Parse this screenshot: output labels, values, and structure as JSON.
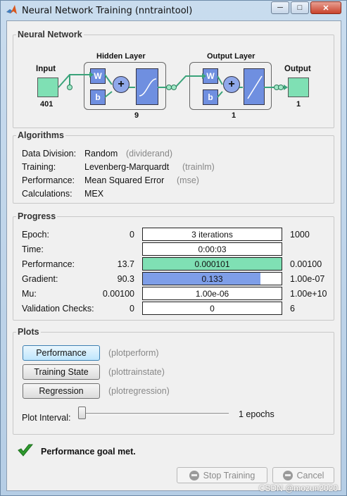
{
  "window": {
    "title": "Neural Network Training (nntraintool)",
    "minimize": "─",
    "maximize": "□",
    "close": "✕"
  },
  "network": {
    "section_title": "Neural Network",
    "input_label": "Input",
    "input_size": "401",
    "hidden_title": "Hidden Layer",
    "hidden_size": "9",
    "output_layer_title": "Output Layer",
    "output_layer_size": "1",
    "output_label": "Output",
    "output_size": "1",
    "weight_symbol": "W",
    "bias_symbol": "b",
    "sum_symbol": "+"
  },
  "algorithms": {
    "section_title": "Algorithms",
    "rows": [
      {
        "label": "Data Division:",
        "value": "Random",
        "fn": "(dividerand)"
      },
      {
        "label": "Training:",
        "value": "Levenberg-Marquardt",
        "fn": "(trainlm)"
      },
      {
        "label": "Performance:",
        "value": "Mean Squared Error",
        "fn": "(mse)"
      },
      {
        "label": "Calculations:",
        "value": "MEX",
        "fn": ""
      }
    ]
  },
  "progress": {
    "section_title": "Progress",
    "rows": [
      {
        "label": "Epoch:",
        "start": "0",
        "current": "3 iterations",
        "end": "1000",
        "fill": 0,
        "color": "#ffffff"
      },
      {
        "label": "Time:",
        "start": "",
        "current": "0:00:03",
        "end": "",
        "fill": 0,
        "color": "#ffffff"
      },
      {
        "label": "Performance:",
        "start": "13.7",
        "current": "0.000101",
        "end": "0.00100",
        "fill": 1.0,
        "color": "#7fe0b4"
      },
      {
        "label": "Gradient:",
        "start": "90.3",
        "current": "0.133",
        "end": "1.00e-07",
        "fill": 0.85,
        "color": "#7e9ee8"
      },
      {
        "label": "Mu:",
        "start": "0.00100",
        "current": "1.00e-06",
        "end": "1.00e+10",
        "fill": 0,
        "color": "#ffffff"
      },
      {
        "label": "Validation Checks:",
        "start": "0",
        "current": "0",
        "end": "6",
        "fill": 0,
        "color": "#ffffff"
      }
    ]
  },
  "plots": {
    "section_title": "Plots",
    "buttons": [
      {
        "label": "Performance",
        "fn": "(plotperform)"
      },
      {
        "label": "Training State",
        "fn": "(plottrainstate)"
      },
      {
        "label": "Regression",
        "fn": "(plotregression)"
      }
    ],
    "interval_label": "Plot Interval:",
    "interval_value": "1 epochs",
    "interval_slider": 0
  },
  "status": {
    "message": "Performance goal met."
  },
  "footer": {
    "stop_label": "Stop Training",
    "cancel_label": "Cancel",
    "watermark": "CSDN @mozun2020"
  },
  "colors": {
    "io_box": "#7fe0b4",
    "layer_box": "#6f8fe0",
    "success": "#2e9a2e"
  }
}
